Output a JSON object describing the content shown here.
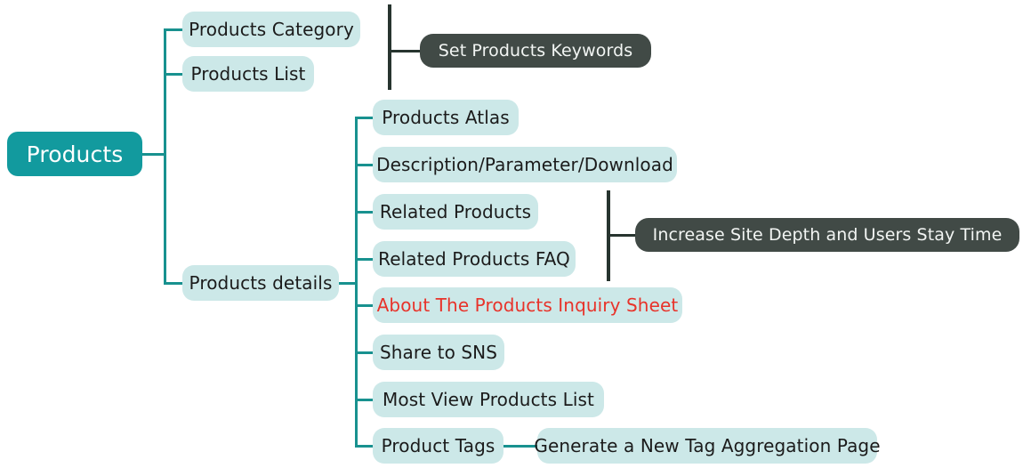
{
  "diagram": {
    "title": "Products",
    "type": "mind-map",
    "colors": {
      "root_fill": "#129a9e",
      "root_text": "#ffffff",
      "node_fill": "#cce8e8",
      "node_text": "#1b1b1b",
      "alert_text": "#e8332a",
      "note_fill": "#414a46",
      "note_text": "#f2f5f3",
      "connector": "#18918f",
      "note_connector": "#27342f",
      "background": "#ffffff"
    }
  },
  "root": {
    "label": "Products"
  },
  "level1": [
    {
      "label": "Products Category"
    },
    {
      "label": "Products List"
    },
    {
      "label": "Products details"
    }
  ],
  "details_children": [
    {
      "label": "Products Atlas",
      "alert": false
    },
    {
      "label": "Description/Parameter/Download",
      "alert": false
    },
    {
      "label": "Related Products",
      "alert": false
    },
    {
      "label": "Related Products FAQ",
      "alert": false
    },
    {
      "label": "About The Products Inquiry Sheet",
      "alert": true
    },
    {
      "label": "Share to SNS",
      "alert": false
    },
    {
      "label": "Most View Products List",
      "alert": false
    },
    {
      "label": "Product Tags",
      "alert": false
    }
  ],
  "notes": [
    {
      "label": "Set Products Keywords"
    },
    {
      "label": "Increase Site Depth and Users Stay Time"
    }
  ],
  "tag_child": {
    "label": "Generate a New Tag Aggregation Page"
  }
}
